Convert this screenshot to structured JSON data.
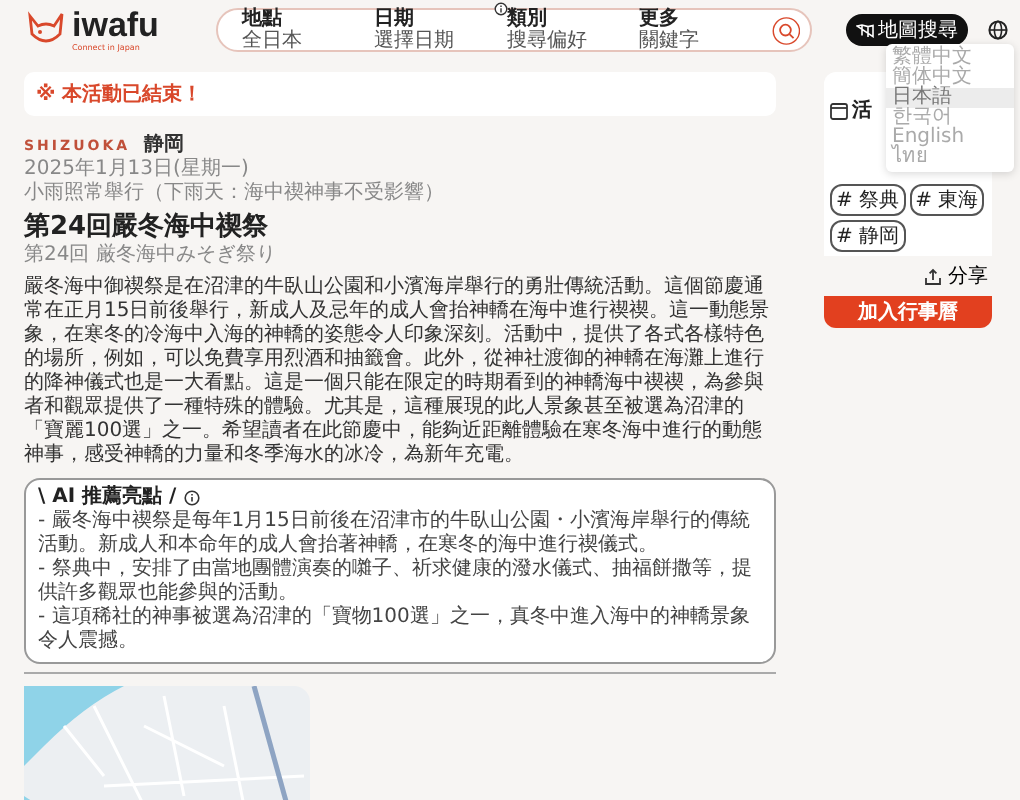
{
  "brand": {
    "name": "iwafu",
    "tagline": "Connect in Japan"
  },
  "search": {
    "fields": [
      {
        "label": "地點",
        "value": "全日本"
      },
      {
        "label": "日期",
        "value": "選擇日期"
      },
      {
        "label": "類別",
        "value": "搜尋偏好"
      },
      {
        "label": "更多",
        "value": "關鍵字"
      }
    ]
  },
  "map_search_button": "地圖搜尋",
  "language_menu": [
    {
      "label": "繁體中文",
      "selected": false
    },
    {
      "label": "簡体中文",
      "selected": false
    },
    {
      "label": "日本語",
      "selected": true
    },
    {
      "label": "한국어",
      "selected": false
    },
    {
      "label": "English",
      "selected": false
    },
    {
      "label": "ไทย",
      "selected": false
    }
  ],
  "notice": "※ 本活動已結束！",
  "region": {
    "romaji": "SHIZUOKA",
    "name": "静岡"
  },
  "date": "2025年1月13日(星期一)",
  "weather_note": "小雨照常舉行（下雨天：海中禊神事不受影響）",
  "title": "第24回嚴冬海中禊祭",
  "subtitle": "第24回 厳冬海中みそぎ祭り",
  "description": "嚴冬海中御禊祭是在沼津的牛臥山公園和小濱海岸舉行的勇壯傳統活動。這個節慶通常在正月15日前後舉行，新成人及忌年的成人會抬神轎在海中進行禊禊。這一動態景象，在寒冬的冷海中入海的神轎的姿態令人印象深刻。活動中，提供了各式各樣特色的場所，例如，可以免費享用烈酒和抽籤會。此外，從神社渡御的神轎在海灘上進行的降神儀式也是一大看點。這是一個只能在限定的時期看到的神轎海中禊禊，為參與者和觀眾提供了一種特殊的體驗。尤其是，這種展現的此人景象甚至被選為沼津的「寶麗100選」之一。希望讀者在此節慶中，能夠近距離體驗在寒冬海中進行的動態神事，感受神轎的力量和冬季海水的冰冷，為新年充電。",
  "ai_highlights": {
    "heading": "\\ AI 推薦亮點 /",
    "points": [
      "- 嚴冬海中禊祭是每年1月15日前後在沼津市的牛臥山公園・小濱海岸舉行的傳統活動。新成人和本命年的成人會抬著神轎，在寒冬的海中進行禊儀式。",
      "- 祭典中，安排了由當地團體演奏的囃子、祈求健康的潑水儀式、抽福餅撒等，提供許多觀眾也能參與的活動。",
      "- 這項稀社的神事被選為沼津的「寶物100選」之一，真冬中進入海中的神轎景象令人震撼。"
    ]
  },
  "side_card": {
    "calendar_label": "活",
    "tags": [
      "# 祭典",
      "# 東海",
      "# 静岡"
    ],
    "share": "分享",
    "add_button": "加入行事曆"
  }
}
